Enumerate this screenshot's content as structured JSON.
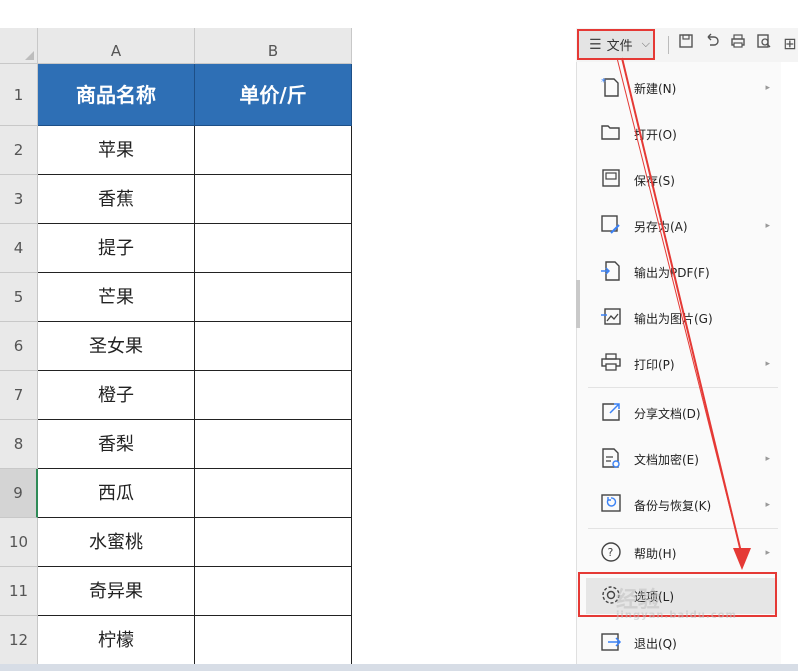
{
  "sheet": {
    "col_a": "A",
    "col_b": "B",
    "header_name": "商品名称",
    "header_price": "单价/斤",
    "rows": [
      {
        "num": "1"
      },
      {
        "num": "2",
        "name": "苹果"
      },
      {
        "num": "3",
        "name": "香蕉"
      },
      {
        "num": "4",
        "name": "提子"
      },
      {
        "num": "5",
        "name": "芒果"
      },
      {
        "num": "6",
        "name": "圣女果"
      },
      {
        "num": "7",
        "name": "橙子"
      },
      {
        "num": "8",
        "name": "香梨"
      },
      {
        "num": "9",
        "name": "西瓜"
      },
      {
        "num": "10",
        "name": "水蜜桃"
      },
      {
        "num": "11",
        "name": "奇异果"
      },
      {
        "num": "12",
        "name": "柠檬"
      }
    ],
    "selected_row": "9"
  },
  "toolbar": {
    "file_label": "文件",
    "icons": [
      "save-icon",
      "undo-icon",
      "print-icon",
      "print-preview-icon"
    ]
  },
  "menu": {
    "items": [
      {
        "label": "新建(N)",
        "icon": "new-file-icon",
        "submenu": true
      },
      {
        "label": "打开(O)",
        "icon": "open-folder-icon",
        "submenu": false
      },
      {
        "label": "保存(S)",
        "icon": "save-icon",
        "submenu": false
      },
      {
        "label": "另存为(A)",
        "icon": "save-as-icon",
        "submenu": true
      },
      {
        "label": "输出为PDF(F)",
        "icon": "export-pdf-icon",
        "submenu": false
      },
      {
        "label": "输出为图片(G)",
        "icon": "export-image-icon",
        "submenu": false
      },
      {
        "label": "打印(P)",
        "icon": "print-icon",
        "submenu": true
      },
      {
        "label": "分享文档(D)",
        "icon": "share-icon",
        "submenu": false
      },
      {
        "label": "文档加密(E)",
        "icon": "encrypt-icon",
        "submenu": true
      },
      {
        "label": "备份与恢复(K)",
        "icon": "backup-icon",
        "submenu": true
      },
      {
        "label": "帮助(H)",
        "icon": "help-icon",
        "submenu": true
      },
      {
        "label": "选项(L)",
        "icon": "gear-icon",
        "submenu": false
      },
      {
        "label": "退出(Q)",
        "icon": "exit-icon",
        "submenu": false
      }
    ]
  },
  "watermark": {
    "main": "经验",
    "sub": "jingyan.baidu.com"
  },
  "colors": {
    "header_blue": "#2e6fb5",
    "annotation_red": "#e53935",
    "selected_row_green": "#2e8b57"
  }
}
